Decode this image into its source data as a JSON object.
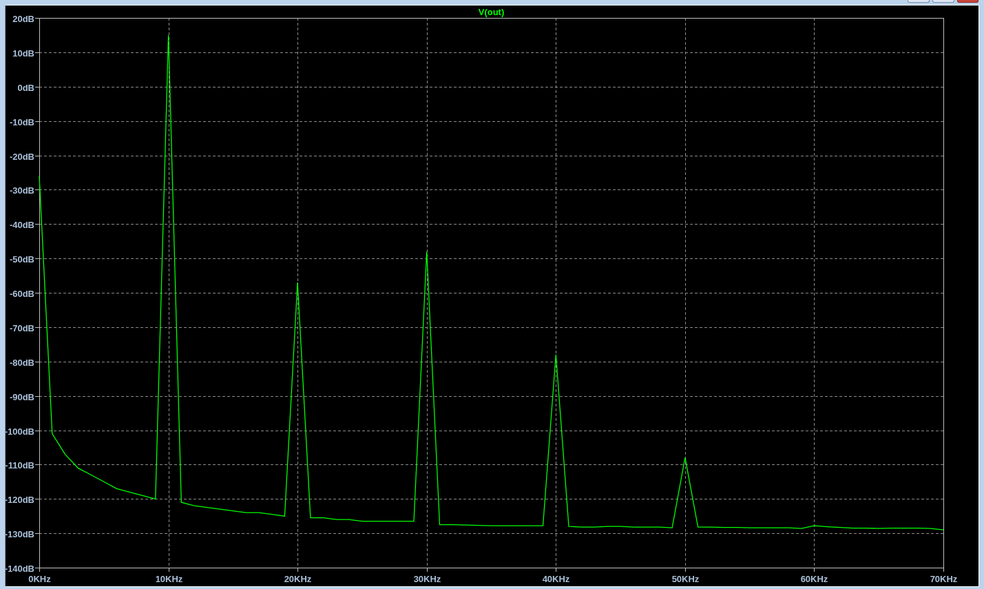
{
  "window": {
    "controls": [
      {
        "kind": "minimize"
      },
      {
        "kind": "maximize"
      },
      {
        "kind": "close"
      }
    ]
  },
  "plot": {
    "chart_data": {
      "type": "line",
      "grid": true,
      "x": [
        0,
        1,
        2,
        3,
        4,
        5,
        6,
        7,
        8,
        9,
        10,
        11,
        12,
        13,
        14,
        15,
        16,
        17,
        18,
        19,
        20,
        21,
        22,
        23,
        24,
        25,
        26,
        27,
        28,
        29,
        30,
        31,
        32,
        33,
        34,
        35,
        36,
        37,
        38,
        39,
        40,
        41,
        42,
        43,
        44,
        45,
        46,
        47,
        48,
        49,
        50,
        51,
        52,
        53,
        54,
        55,
        56,
        57,
        58,
        59,
        60,
        61,
        62,
        63,
        64,
        65,
        66,
        67,
        68,
        69,
        70
      ],
      "series": [
        {
          "name": "V(out)",
          "color": "#00ff00",
          "values": [
            -26,
            -101,
            -107,
            -111,
            -113,
            -115,
            -117,
            -118,
            -119,
            -120,
            15,
            -121,
            -122,
            -122.5,
            -123,
            -123.5,
            -124,
            -124,
            -124.5,
            -125,
            -57,
            -125.5,
            -125.5,
            -126,
            -126,
            -126.5,
            -126.5,
            -126.5,
            -126.5,
            -126.5,
            -48,
            -127.5,
            -127.5,
            -127.6,
            -127.7,
            -127.8,
            -127.8,
            -127.8,
            -127.8,
            -127.8,
            -78,
            -128,
            -128.2,
            -128.2,
            -128,
            -128,
            -128.2,
            -128.2,
            -128.2,
            -128.4,
            -108,
            -128.2,
            -128.2,
            -128.3,
            -128.3,
            -128.4,
            -128.4,
            -128.4,
            -128.4,
            -128.6,
            -127.8,
            -128.1,
            -128.3,
            -128.5,
            -128.5,
            -128.6,
            -128.5,
            -128.5,
            -128.5,
            -128.6,
            -129
          ]
        }
      ],
      "xlim": [
        0,
        70
      ],
      "ylim": [
        -140,
        20
      ],
      "xticks": [
        {
          "value": 0,
          "label": "0KHz"
        },
        {
          "value": 10,
          "label": "10KHz"
        },
        {
          "value": 20,
          "label": "20KHz"
        },
        {
          "value": 30,
          "label": "30KHz"
        },
        {
          "value": 40,
          "label": "40KHz"
        },
        {
          "value": 50,
          "label": "50KHz"
        },
        {
          "value": 60,
          "label": "60KHz"
        },
        {
          "value": 70,
          "label": "70KHz"
        }
      ],
      "yticks": [
        {
          "value": 20,
          "label": "20dB"
        },
        {
          "value": 10,
          "label": "10dB"
        },
        {
          "value": 0,
          "label": "0dB"
        },
        {
          "value": -10,
          "label": "-10dB"
        },
        {
          "value": -20,
          "label": "-20dB"
        },
        {
          "value": -30,
          "label": "-30dB"
        },
        {
          "value": -40,
          "label": "-40dB"
        },
        {
          "value": -50,
          "label": "-50dB"
        },
        {
          "value": -60,
          "label": "-60dB"
        },
        {
          "value": -70,
          "label": "-70dB"
        },
        {
          "value": -80,
          "label": "-80dB"
        },
        {
          "value": -90,
          "label": "-90dB"
        },
        {
          "value": -100,
          "label": "-100dB"
        },
        {
          "value": -110,
          "label": "-110dB"
        },
        {
          "value": -120,
          "label": "-120dB"
        },
        {
          "value": -130,
          "label": "-130dB"
        },
        {
          "value": -140,
          "label": "-140dB"
        }
      ]
    }
  }
}
